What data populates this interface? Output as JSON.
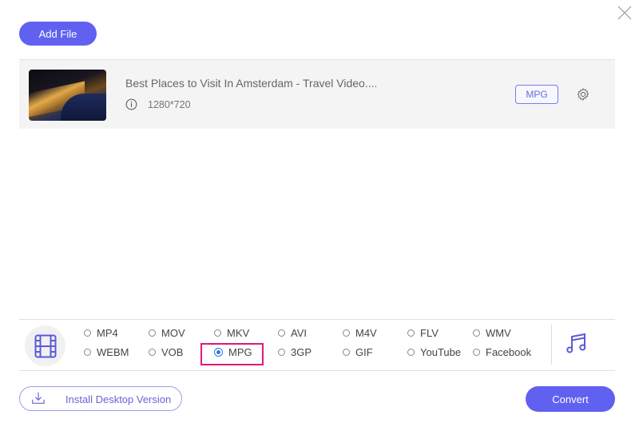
{
  "header": {
    "add_file_label": "Add File",
    "close_icon": "close-icon"
  },
  "file": {
    "title": "Best Places to Visit In Amsterdam - Travel Video....",
    "resolution": "1280*720",
    "output_format": "MPG",
    "thumbnail": "amsterdam-night-aerial-thumbnail"
  },
  "formats": {
    "selected": "MPG",
    "video_options": [
      [
        "MP4",
        "MOV",
        "MKV",
        "AVI",
        "M4V",
        "FLV",
        "WMV"
      ],
      [
        "WEBM",
        "VOB",
        "MPG",
        "3GP",
        "GIF",
        "YouTube",
        "Facebook"
      ]
    ],
    "highlight_color": "#e0187c"
  },
  "footer": {
    "install_label": "Install Desktop Version",
    "convert_label": "Convert"
  },
  "colors": {
    "accent": "#6061f0",
    "radio_selected": "#2c7be5"
  }
}
